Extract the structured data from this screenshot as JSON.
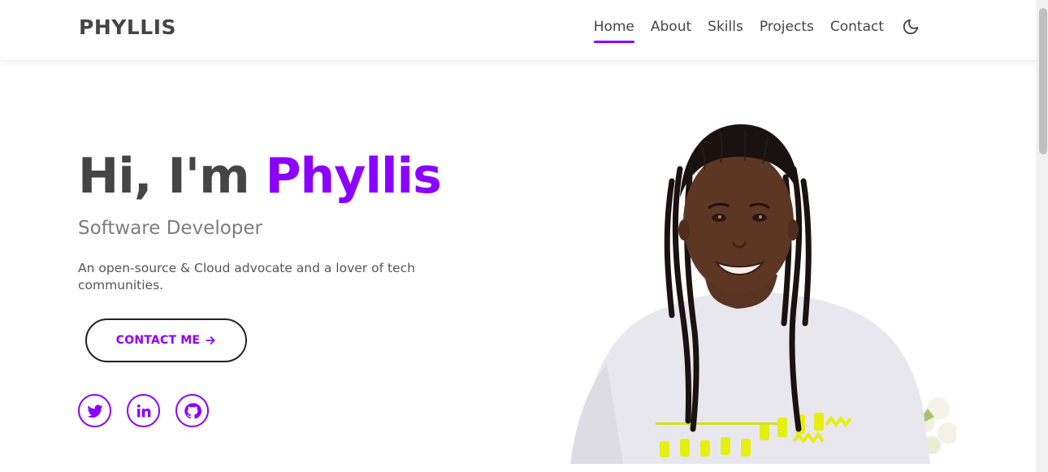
{
  "header": {
    "logo": "PHYLLIS",
    "nav": [
      {
        "label": "Home",
        "active": true
      },
      {
        "label": "About",
        "active": false
      },
      {
        "label": "Skills",
        "active": false
      },
      {
        "label": "Projects",
        "active": false
      },
      {
        "label": "Contact",
        "active": false
      }
    ],
    "theme_toggle_icon": "moon-icon"
  },
  "hero": {
    "greeting": "Hi, I'm ",
    "name": "Phyllis",
    "subtitle": "Software Developer",
    "description": "An open-source & Cloud advocate and a lover of tech communities.",
    "contact_button": "CONTACT ME",
    "contact_button_icon": "arrow-right-icon",
    "socials": [
      {
        "icon": "twitter-icon"
      },
      {
        "icon": "linkedin-icon"
      },
      {
        "icon": "github-icon"
      }
    ]
  },
  "colors": {
    "accent": "#8b00ff",
    "text": "#454545",
    "muted": "#7d7d7d"
  }
}
